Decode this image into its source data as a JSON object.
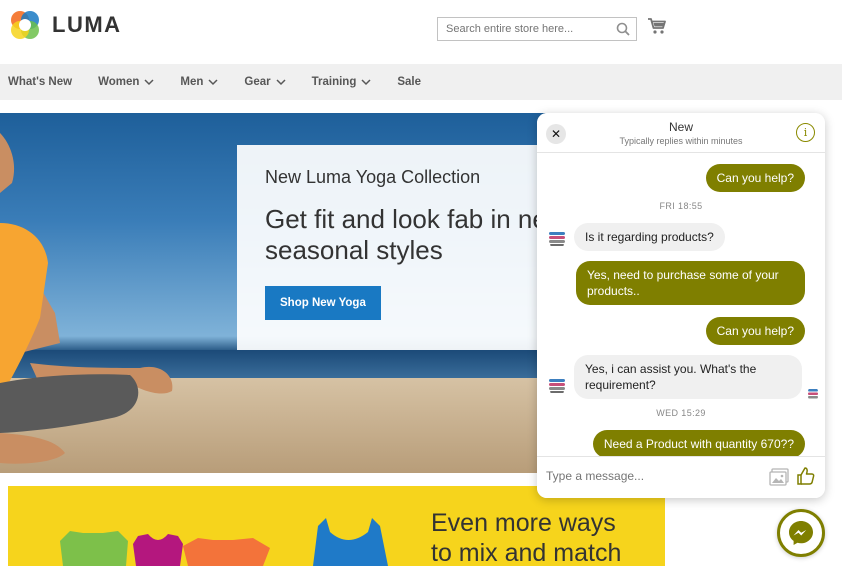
{
  "brand": {
    "name": "LUMA"
  },
  "search": {
    "placeholder": "Search entire store here..."
  },
  "nav": {
    "items": [
      {
        "label": "What's New",
        "has_dropdown": false
      },
      {
        "label": "Women",
        "has_dropdown": true
      },
      {
        "label": "Men",
        "has_dropdown": true
      },
      {
        "label": "Gear",
        "has_dropdown": true
      },
      {
        "label": "Training",
        "has_dropdown": true
      },
      {
        "label": "Sale",
        "has_dropdown": false
      }
    ]
  },
  "hero": {
    "title": "New Luma Yoga Collection",
    "headline": "Get fit and look fab in new seasonal styles",
    "cta": "Shop New Yoga"
  },
  "banner": {
    "line1": "Even more ways",
    "line2": "to mix and match"
  },
  "chat": {
    "title": "New",
    "subtitle": "Typically replies within minutes",
    "input_placeholder": "Type a message...",
    "messages": [
      {
        "from": "user",
        "text": "Can you help?"
      },
      {
        "type": "timestamp",
        "text": "FRI 18:55"
      },
      {
        "from": "page",
        "text": "Is it regarding products?"
      },
      {
        "from": "user",
        "text": "Yes, need to purchase some of your products.."
      },
      {
        "from": "user",
        "text": "Can you help?"
      },
      {
        "from": "page",
        "text": "Yes, i can assist you. What's the requirement?"
      },
      {
        "type": "timestamp",
        "text": "WED 15:29"
      },
      {
        "from": "user",
        "text": "Need a Product with quantity 670??"
      }
    ]
  },
  "colors": {
    "accent_olive": "#7f7f00",
    "button_blue": "#1979c3",
    "banner_yellow": "#f6d41c",
    "nav_bg": "#f0f0f0"
  },
  "icons": [
    "luma-logo-icon",
    "search-icon",
    "cart-icon",
    "chevron-down-icon",
    "close-icon",
    "info-icon",
    "image-icon",
    "thumbs-up-icon",
    "messenger-icon"
  ]
}
